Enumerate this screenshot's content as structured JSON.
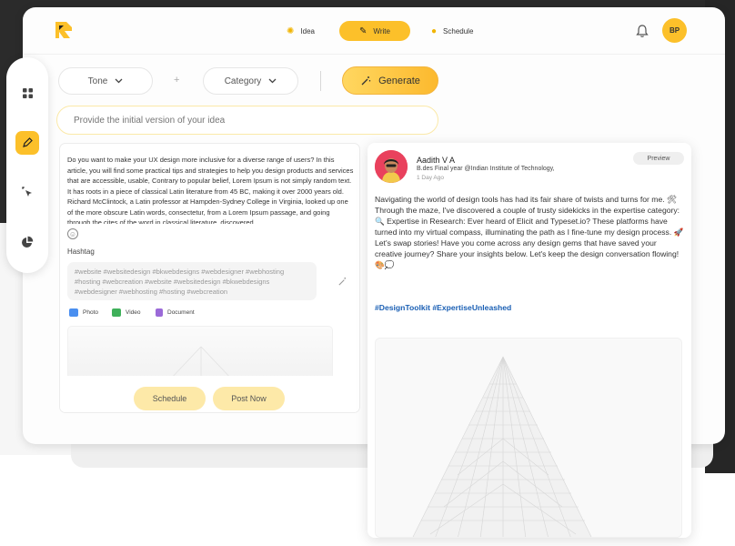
{
  "topbar": {
    "nav": [
      {
        "label": "Idea",
        "icon": "bulb-icon"
      },
      {
        "label": "Write",
        "icon": "pencil-icon"
      },
      {
        "label": "Schedule",
        "icon": "clock-icon"
      }
    ],
    "avatar_initials": "BP"
  },
  "controls": {
    "tone_label": "Tone",
    "plus": "+",
    "category_label": "Category",
    "generate_label": "Generate",
    "idea_placeholder": "Provide the initial version of your idea"
  },
  "editor": {
    "text": "Do you want to make your UX design more inclusive for a diverse range of users? In this article, you will find some practical tips and strategies to help you design products and services that are accessible, usable, Contrary to popular belief, Lorem Ipsum is not simply random text. It has roots in a piece of classical Latin literature from 45 BC, making it over 2000 years old. Richard McClintock, a Latin professor at Hampden-Sydney College in Virginia, looked up one of the more obscure Latin words, consectetur, from a Lorem Ipsum passage, and going through the cites of the word in classical literature, discovered",
    "hashtag_label": "Hashtag",
    "hashtags": "#website #websitedesign #bkwebdesigns #webdesigner #webhosting #hosting #webcreation  #website #websitedesign #bkwebdesigns #webdesigner #webhosting #hosting #webcreation",
    "attachments": {
      "photo": "Photo",
      "video": "Video",
      "document": "Document"
    },
    "schedule_label": "Schedule",
    "post_now_label": "Post Now"
  },
  "preview": {
    "name": "Aadith V A",
    "role": "B.des Final year @Indian Institute of Technology,",
    "time": "1 Day Ago",
    "preview_label": "Preview",
    "body": [
      "Navigating the world of design tools has had its fair share of twists and turns for me. 🛠 Through the maze, I've discovered a couple of trusty sidekicks in the expertise category:",
      "🔍 Expertise in Research: Ever heard of Elicit and Typeset.io? These platforms have turned into my virtual compass, illuminating the path as I fine-tune my design process. 🚀",
      "Let's swap stories! Have you come across any design gems that have saved your creative journey? Share your insights below. Let's keep the design conversation flowing! 🎨💭"
    ],
    "tags": "#DesignToolkit #ExpertiseUnleashed"
  },
  "colors": {
    "accent": "#fcc02a",
    "accent_soft": "#fde9a8",
    "hashtag_blue": "#1a5fb4"
  }
}
